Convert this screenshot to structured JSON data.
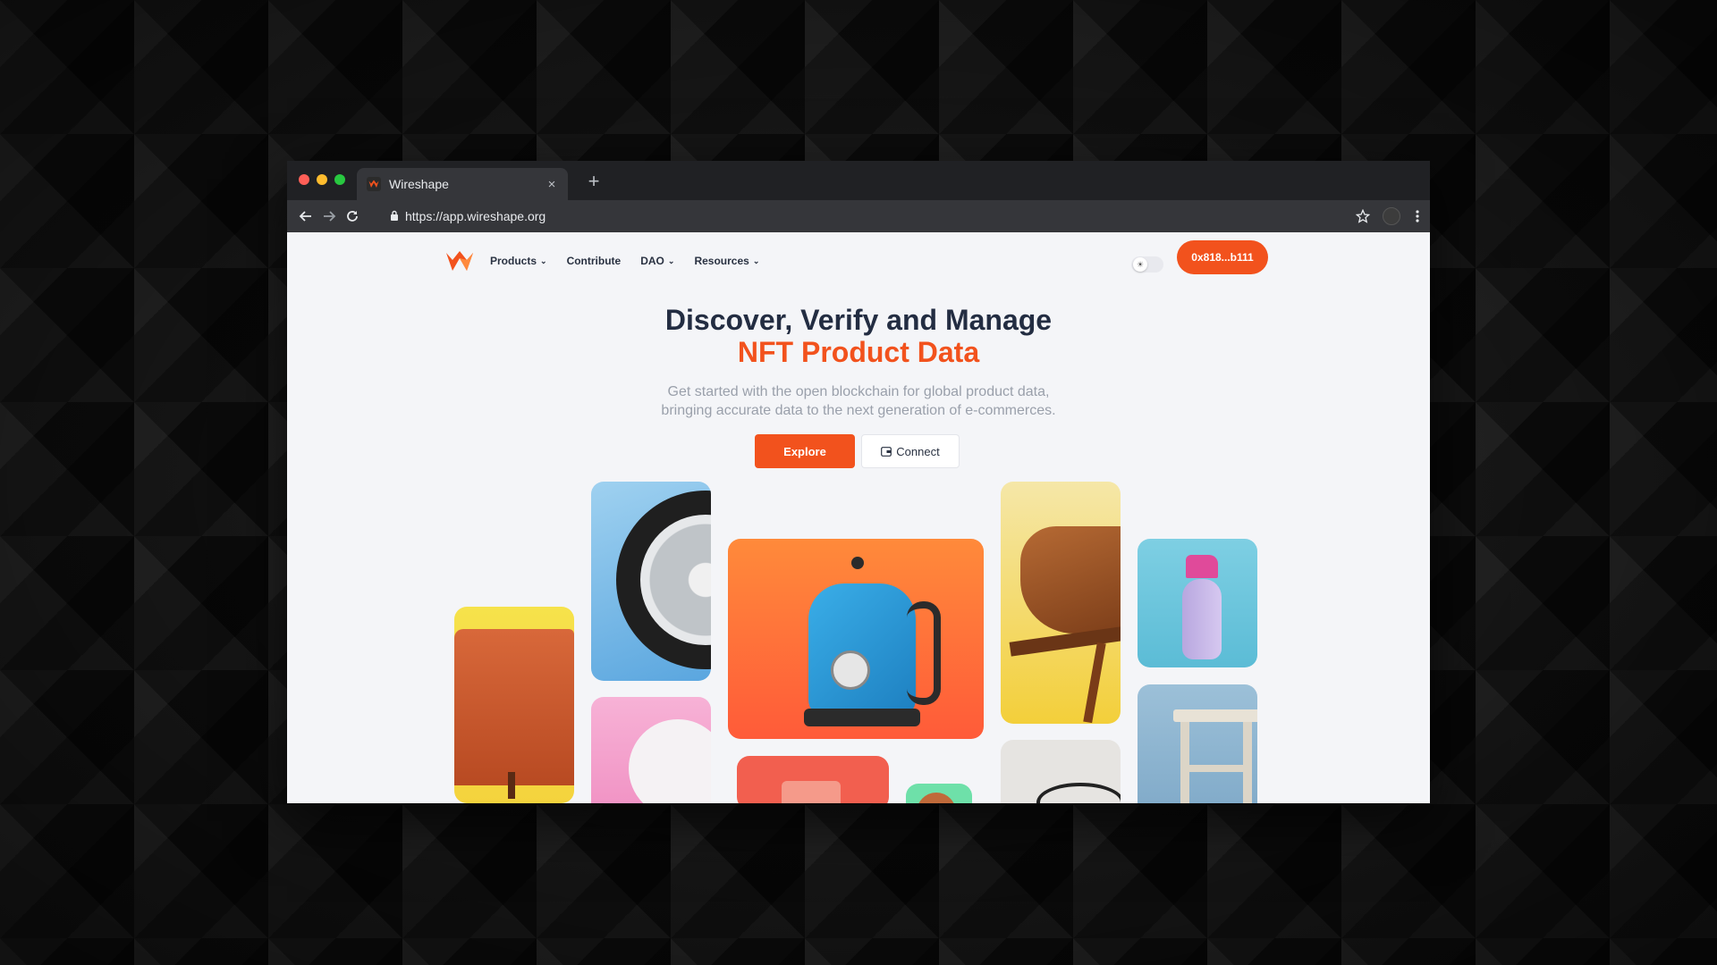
{
  "browser": {
    "tab_title": "Wireshape",
    "tab_close": "×",
    "new_tab": "+",
    "url": "https://app.wireshape.org"
  },
  "nav": {
    "items": [
      {
        "label": "Products",
        "has_dropdown": true
      },
      {
        "label": "Contribute",
        "has_dropdown": false
      },
      {
        "label": "DAO",
        "has_dropdown": true
      },
      {
        "label": "Resources",
        "has_dropdown": true
      }
    ],
    "wallet_label": "0x818...b111"
  },
  "hero": {
    "title_line1": "Discover, Verify and Manage",
    "title_line2": "NFT Product Data",
    "subtitle_line1": "Get started with the open blockchain for global product data,",
    "subtitle_line2": "bringing accurate data to the next generation of e-commerces.",
    "explore_label": "Explore",
    "connect_label": "Connect"
  },
  "colors": {
    "accent": "#f2521d",
    "title": "#232d42",
    "subtitle": "#9aa0ab",
    "page_bg": "#f4f5f8"
  },
  "gallery": {
    "items": [
      "armchair",
      "wheel",
      "lamp",
      "kettle",
      "cup",
      "ball",
      "chair",
      "headphones",
      "spray-bottle",
      "stool"
    ]
  }
}
